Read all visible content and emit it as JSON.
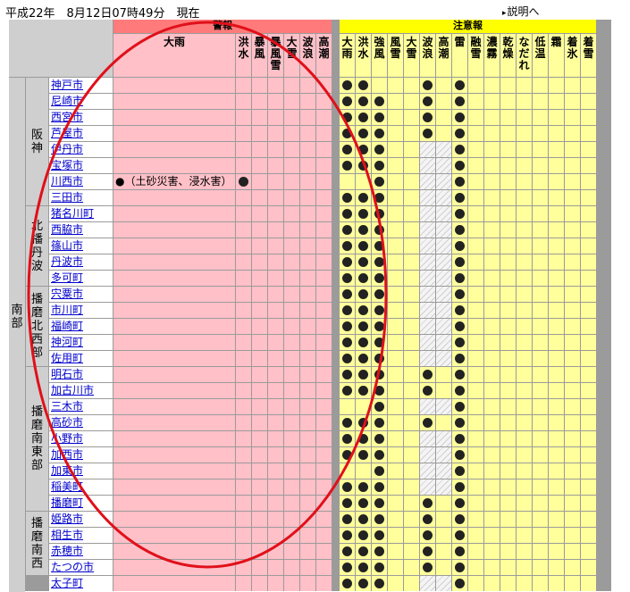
{
  "timestamp": "平成22年　8月12日07時49分　現在",
  "help_link": "説明へ",
  "help_icon": "triangle-right-icon",
  "bands": {
    "warning": "警報",
    "advisory": "注意報"
  },
  "warning_columns": [
    "大雨",
    "洪水",
    "暴風",
    "暴風雪",
    "大雪",
    "波浪",
    "高潮"
  ],
  "advisory_columns": [
    "大雨",
    "洪水",
    "強風",
    "風雪",
    "大雪",
    "波浪",
    "高潮",
    "雷",
    "融雪",
    "濃霧",
    "乾燥",
    "なだれ",
    "低温",
    "霜",
    "着氷",
    "着雪"
  ],
  "area": "南部",
  "regions": [
    {
      "name": "阪神",
      "rows": 8
    },
    {
      "name": "北播丹波",
      "rows": 5
    },
    {
      "name": "播磨北西部",
      "rows": 5
    },
    {
      "name": "播磨南東部",
      "rows": 9
    },
    {
      "name": "播磨南西",
      "rows": 4
    }
  ],
  "cities": [
    {
      "name": "神戸市",
      "warn": [],
      "adv": [
        0,
        1,
        5,
        7
      ],
      "hatch": []
    },
    {
      "name": "尼崎市",
      "warn": [],
      "adv": [
        0,
        1,
        2,
        5,
        7
      ],
      "hatch": []
    },
    {
      "name": "西宮市",
      "warn": [],
      "adv": [
        0,
        1,
        2,
        5,
        7
      ],
      "hatch": []
    },
    {
      "name": "芦屋市",
      "warn": [],
      "adv": [
        0,
        1,
        2,
        5,
        7
      ],
      "hatch": []
    },
    {
      "name": "伊丹市",
      "warn": [],
      "adv": [
        0,
        1,
        2,
        7
      ],
      "hatch": [
        5,
        6
      ]
    },
    {
      "name": "宝塚市",
      "warn": [],
      "adv": [
        0,
        1,
        2,
        7
      ],
      "hatch": [
        5,
        6
      ]
    },
    {
      "name": "川西市",
      "warn": [
        0,
        1
      ],
      "adv": [
        2,
        7
      ],
      "hatch": [
        5,
        6
      ],
      "note": "●（土砂災害、浸水害）"
    },
    {
      "name": "三田市",
      "warn": [],
      "adv": [
        0,
        1,
        2,
        7
      ],
      "hatch": [
        5,
        6
      ]
    },
    {
      "name": "猪名川町",
      "warn": [],
      "adv": [
        0,
        1,
        2,
        7
      ],
      "hatch": [
        5,
        6
      ]
    },
    {
      "name": "西脇市",
      "warn": [],
      "adv": [
        0,
        1,
        2,
        7
      ],
      "hatch": [
        5,
        6
      ]
    },
    {
      "name": "篠山市",
      "warn": [],
      "adv": [
        0,
        1,
        2,
        7
      ],
      "hatch": [
        5,
        6
      ]
    },
    {
      "name": "丹波市",
      "warn": [],
      "adv": [
        0,
        1,
        2,
        7
      ],
      "hatch": [
        5,
        6
      ]
    },
    {
      "name": "多可町",
      "warn": [],
      "adv": [
        0,
        1,
        2,
        7
      ],
      "hatch": [
        5,
        6
      ]
    },
    {
      "name": "宍粟市",
      "warn": [],
      "adv": [
        0,
        1,
        2,
        7
      ],
      "hatch": [
        5,
        6
      ]
    },
    {
      "name": "市川町",
      "warn": [],
      "adv": [
        0,
        1,
        2,
        7
      ],
      "hatch": [
        5,
        6
      ]
    },
    {
      "name": "福崎町",
      "warn": [],
      "adv": [
        0,
        1,
        2,
        7
      ],
      "hatch": [
        5,
        6
      ]
    },
    {
      "name": "神河町",
      "warn": [],
      "adv": [
        0,
        1,
        2,
        7
      ],
      "hatch": [
        5,
        6
      ]
    },
    {
      "name": "佐用町",
      "warn": [],
      "adv": [
        0,
        1,
        2,
        7
      ],
      "hatch": [
        5,
        6
      ]
    },
    {
      "name": "明石市",
      "warn": [],
      "adv": [
        0,
        1,
        2,
        5,
        7
      ],
      "hatch": []
    },
    {
      "name": "加古川市",
      "warn": [],
      "adv": [
        0,
        1,
        2,
        5,
        7
      ],
      "hatch": []
    },
    {
      "name": "三木市",
      "warn": [],
      "adv": [
        2,
        7
      ],
      "hatch": [
        5,
        6
      ]
    },
    {
      "name": "高砂市",
      "warn": [],
      "adv": [
        0,
        1,
        2,
        5,
        7
      ],
      "hatch": []
    },
    {
      "name": "小野市",
      "warn": [],
      "adv": [
        0,
        1,
        2,
        7
      ],
      "hatch": [
        5,
        6
      ]
    },
    {
      "name": "加西市",
      "warn": [],
      "adv": [
        0,
        1,
        2,
        7
      ],
      "hatch": [
        5,
        6
      ]
    },
    {
      "name": "加東市",
      "warn": [],
      "adv": [
        2,
        7
      ],
      "hatch": [
        5,
        6
      ]
    },
    {
      "name": "稲美町",
      "warn": [],
      "adv": [
        0,
        1,
        2,
        7
      ],
      "hatch": [
        5,
        6
      ]
    },
    {
      "name": "播磨町",
      "warn": [],
      "adv": [
        0,
        1,
        2,
        5,
        7
      ],
      "hatch": []
    },
    {
      "name": "姫路市",
      "warn": [],
      "adv": [
        0,
        1,
        2,
        5,
        7
      ],
      "hatch": []
    },
    {
      "name": "相生市",
      "warn": [],
      "adv": [
        0,
        1,
        2,
        5,
        7
      ],
      "hatch": []
    },
    {
      "name": "赤穂市",
      "warn": [],
      "adv": [
        0,
        1,
        2,
        5,
        7
      ],
      "hatch": []
    },
    {
      "name": "たつの市",
      "warn": [],
      "adv": [
        0,
        1,
        2,
        5,
        7
      ],
      "hatch": []
    },
    {
      "name": "太子町",
      "warn": [],
      "adv": [
        0,
        1,
        2,
        7
      ],
      "hatch": [
        5,
        6
      ]
    }
  ],
  "colors": {
    "warning_band": "#ff7b7b",
    "warning_cell": "#ffc0c8",
    "advisory_band": "#ffff00",
    "advisory_cell": "#ffff9c",
    "annotation": "#e0101a"
  }
}
